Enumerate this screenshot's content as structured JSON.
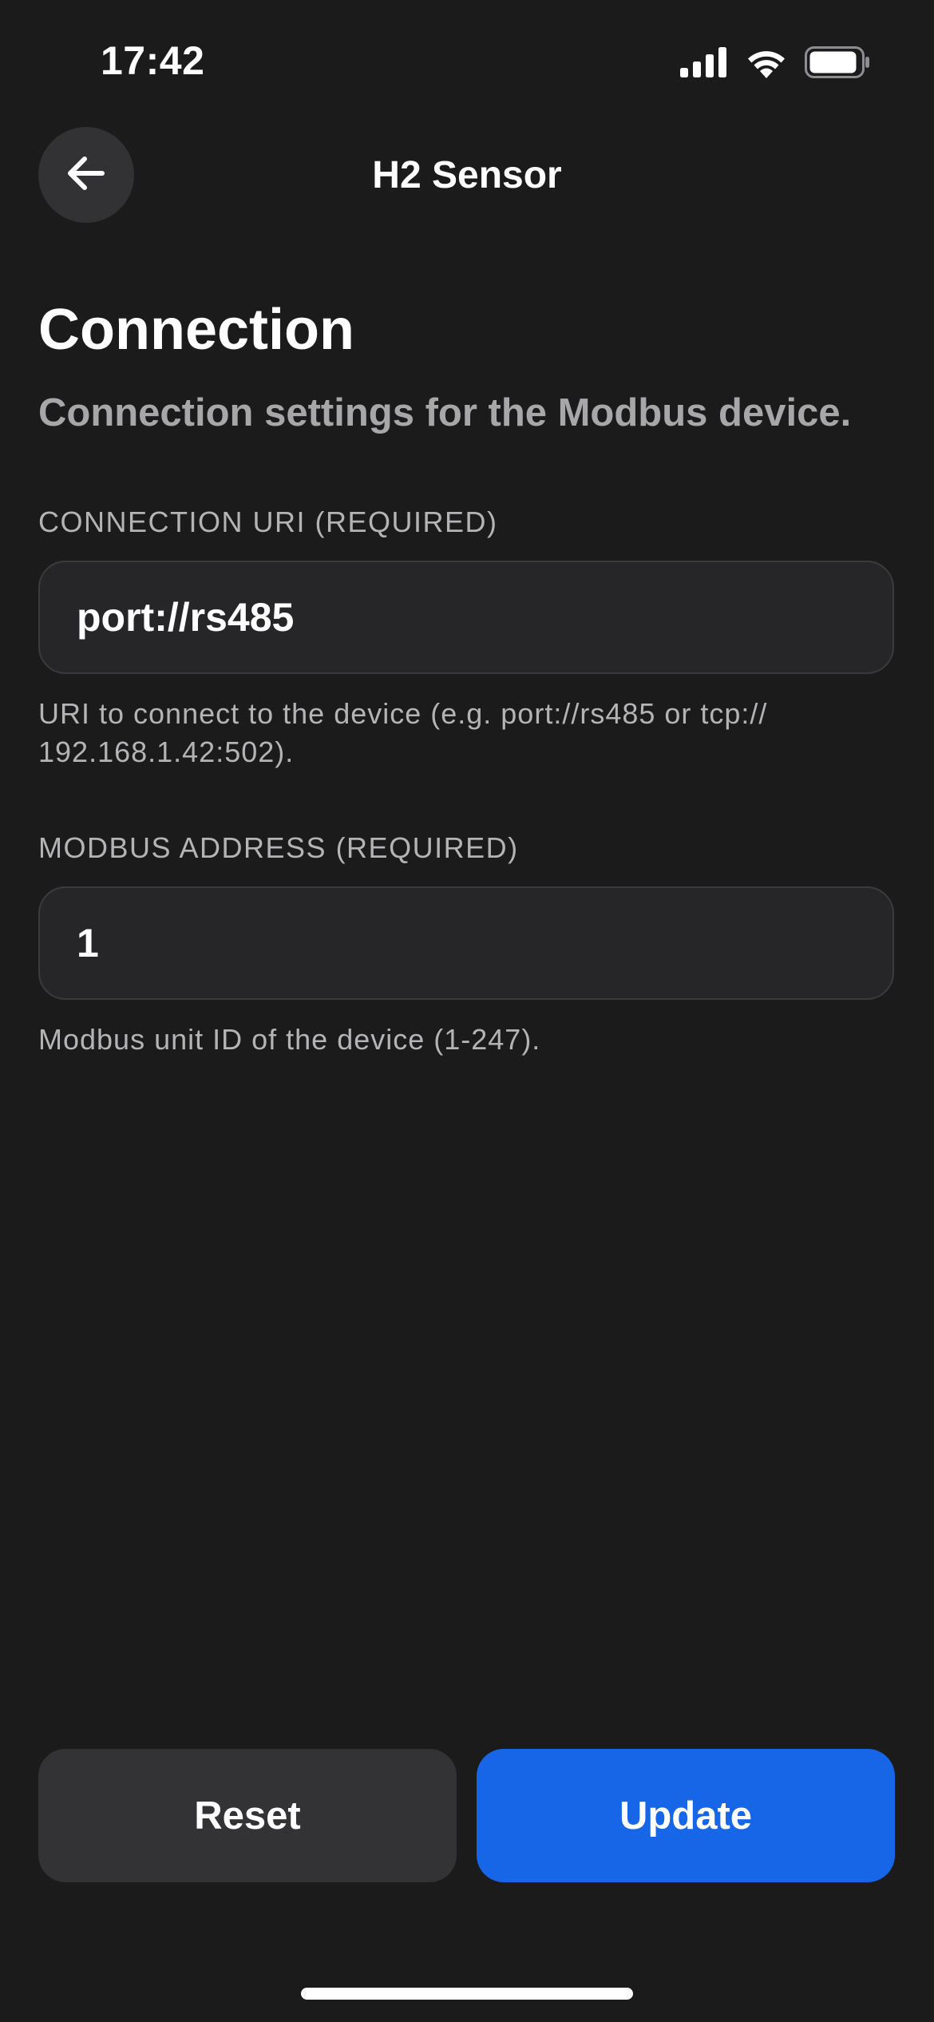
{
  "status_bar": {
    "time": "17:42",
    "icons": [
      "cellular-signal-icon",
      "wifi-icon",
      "battery-icon"
    ]
  },
  "header": {
    "title": "H2 Sensor",
    "back_icon": "arrow-left-icon"
  },
  "section": {
    "title": "Connection",
    "subtitle": "Connection settings for the Modbus device."
  },
  "fields": [
    {
      "label": "CONNECTION URI (REQUIRED)",
      "value": "port://rs485",
      "hint_line1": "URI to connect to the device (e.g. port://rs485 or tcp://",
      "hint_line2": "192.168.1.42:502)."
    },
    {
      "label": "MODBUS ADDRESS (REQUIRED)",
      "value": "1",
      "hint_line1": "Modbus unit ID of the device (1-247)."
    }
  ],
  "actions": {
    "reset_label": "Reset",
    "update_label": "Update"
  },
  "colors": {
    "background": "#1b1b1c",
    "input_background": "#262628",
    "secondary_button": "#333335",
    "accent": "#1766e8",
    "muted_text": "#b4b4b7"
  }
}
